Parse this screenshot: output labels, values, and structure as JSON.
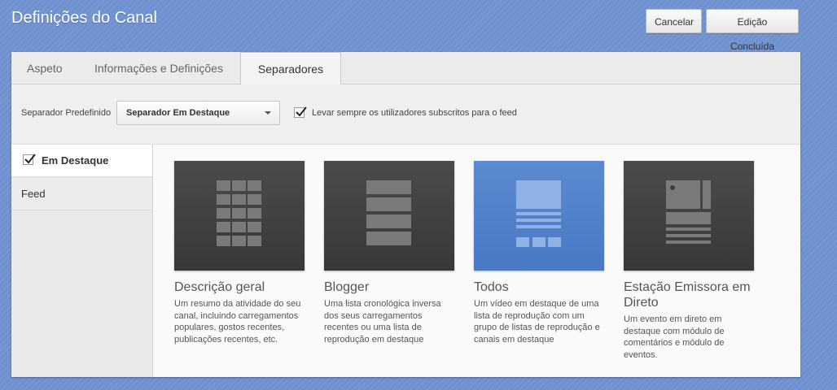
{
  "header": {
    "title": "Definições do Canal",
    "cancel_label": "Cancelar",
    "done_label": "Edição Concluída"
  },
  "tabs": [
    {
      "label": "Aspeto",
      "active": false
    },
    {
      "label": "Informações e Definições",
      "active": false
    },
    {
      "label": "Separadores",
      "active": true
    }
  ],
  "settings": {
    "default_tab_label": "Separador Predefinido",
    "default_tab_value": "Separador Em Destaque",
    "subscribers_checked": true,
    "subscribers_label": "Levar sempre os utilizadores subscritos para o feed"
  },
  "sidebar": {
    "items": [
      {
        "label": "Em Destaque",
        "checked": true,
        "active": true
      },
      {
        "label": "Feed",
        "active": false
      }
    ]
  },
  "templates": [
    {
      "title": "Descrição geral",
      "icon": "grid-layout-icon",
      "selected": false,
      "description": "Um resumo da atividade do seu canal, incluindo carregamentos populares, gostos recentes, publicações recentes, etc."
    },
    {
      "title": "Blogger",
      "icon": "stacked-list-icon",
      "selected": false,
      "description": "Uma lista cronológica inversa dos seus carregamentos recentes ou uma lista de reprodução em destaque"
    },
    {
      "title": "Todos",
      "icon": "featured-video-layout-icon",
      "selected": true,
      "description": "Um vídeo em destaque de uma lista de reprodução com um grupo de listas de reprodução e canais em destaque"
    },
    {
      "title": "Estação Emissora em Direto",
      "icon": "live-broadcast-layout-icon",
      "selected": false,
      "description": "Um evento em direto em destaque com módulo de comentários e módulo de eventos."
    }
  ],
  "colors": {
    "background": "#6f91cf",
    "selected_card": "#5b8ad0",
    "card": "#444444"
  }
}
